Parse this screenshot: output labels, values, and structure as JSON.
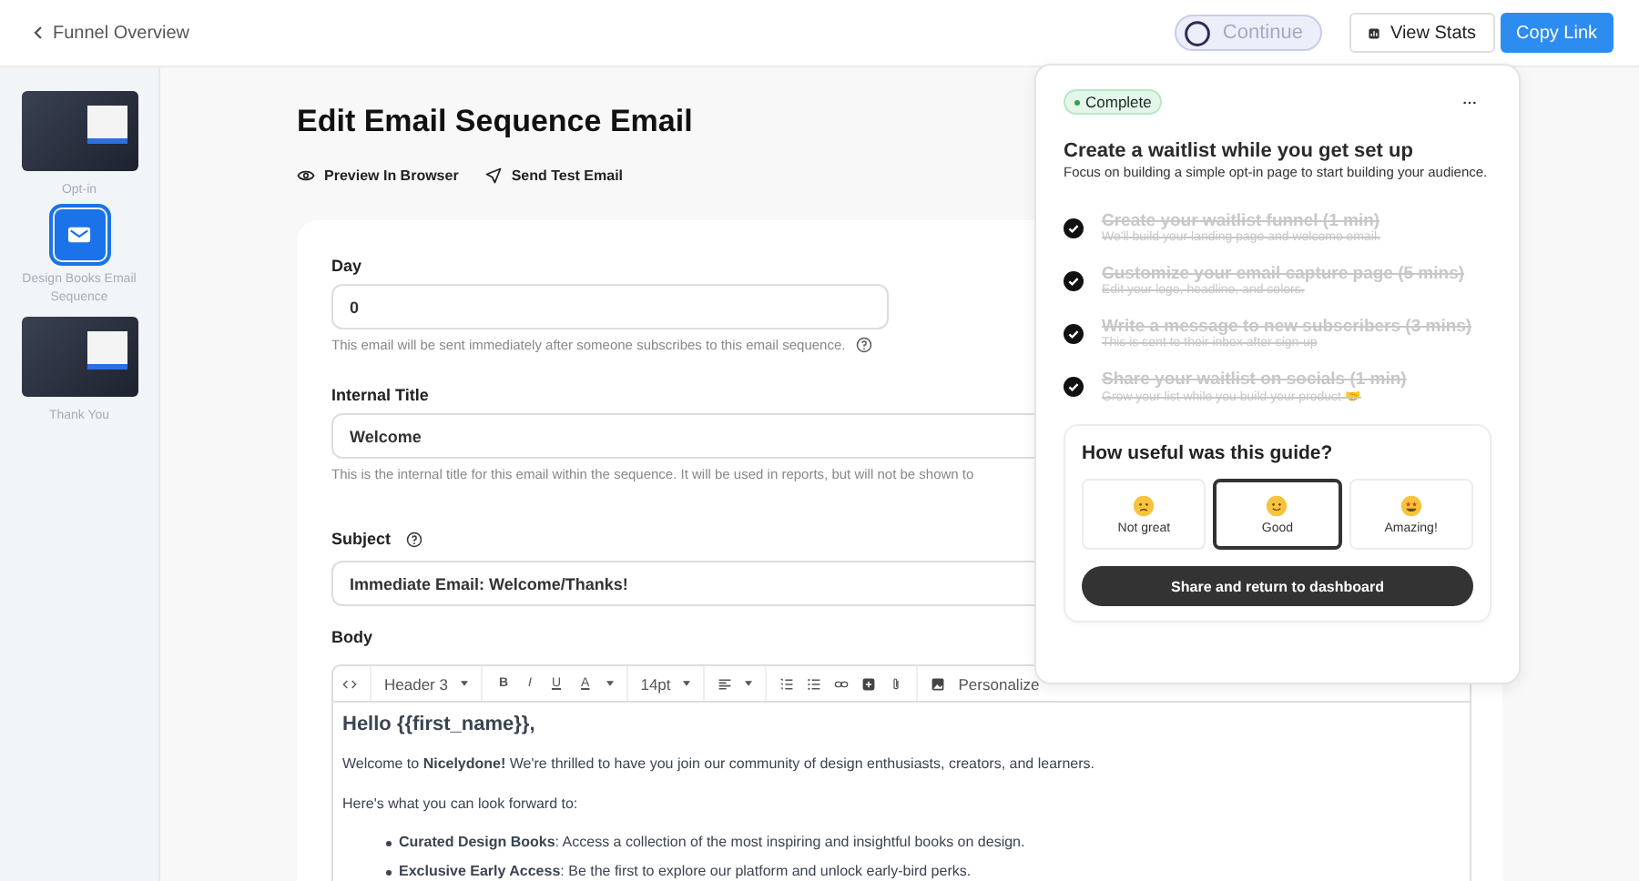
{
  "top_bar": {
    "back_link": "Funnel Overview",
    "continue_button": "Continue",
    "view_stats_button": "View Stats",
    "copy_link_button": "Copy Link"
  },
  "sidebar": {
    "steps": [
      {
        "kind": "page",
        "label": "Opt-in",
        "selected": false
      },
      {
        "kind": "email",
        "label": "Design Books Email Sequence",
        "selected": true
      },
      {
        "kind": "page",
        "label": "Thank You",
        "selected": false
      }
    ]
  },
  "page_title": "Edit Email Sequence Email",
  "actions": [
    "Preview In Browser",
    "Send Test Email"
  ],
  "form": {
    "day": {
      "label": "Day",
      "value": "0",
      "help": "This email will be sent immediately after someone subscribes to this email sequence."
    },
    "internal_title": {
      "label": "Internal Title",
      "value": "Welcome",
      "help": "This is the internal title for this email within the sequence. It will be used in reports, but will not be shown to"
    },
    "subject": {
      "label": "Subject",
      "value": "Immediate Email: Welcome/Thanks!"
    },
    "body": {
      "label": "Body",
      "toolbar": {
        "block_style": "Header 3",
        "bold": "B",
        "italic": "I",
        "underline": "U",
        "text_color": "A",
        "font_size": "14pt",
        "personalize": "Personalize"
      },
      "heading": "Hello {{first_name}},",
      "paragraphs": [
        "Welcome to **Nicelydone!** We're thrilled to have you join our community of design enthusiasts, creators, and learners.",
        "Here's what you can look forward to:"
      ],
      "bullets": [
        "**Curated Design Books**: Access a collection of the most inspiring and insightful books on design.",
        "**Exclusive Early Access**: Be the first to explore our platform and unlock early-bird perks."
      ]
    }
  },
  "guide": {
    "status": "Complete",
    "title": "Create a waitlist while you get set up",
    "subtitle": "Focus on building a simple opt-in page to start building your audience.",
    "tasks": [
      {
        "title": "Create your waitlist funnel (1 min)",
        "detail": "We'll build your landing page and welcome email.",
        "done": true
      },
      {
        "title": "Customize your email capture page (5 mins)",
        "detail": "Edit your logo, headline, and colors.",
        "done": true
      },
      {
        "title": "Write a message to new subscribers (3 mins)",
        "detail": "This is sent to their inbox after sign-up",
        "done": true
      },
      {
        "title": "Share your waitlist on socials (1 min)",
        "detail": "Grow your list while you build your product 🤝",
        "done": true
      }
    ],
    "feedback": {
      "question": "How useful was this guide?",
      "options": [
        {
          "kind": "meh",
          "label": "Not great",
          "selected": false
        },
        {
          "kind": "smile",
          "label": "Good",
          "selected": true
        },
        {
          "kind": "starry",
          "label": "Amazing!",
          "selected": false
        }
      ],
      "share_button": "Share and return to dashboard"
    }
  }
}
